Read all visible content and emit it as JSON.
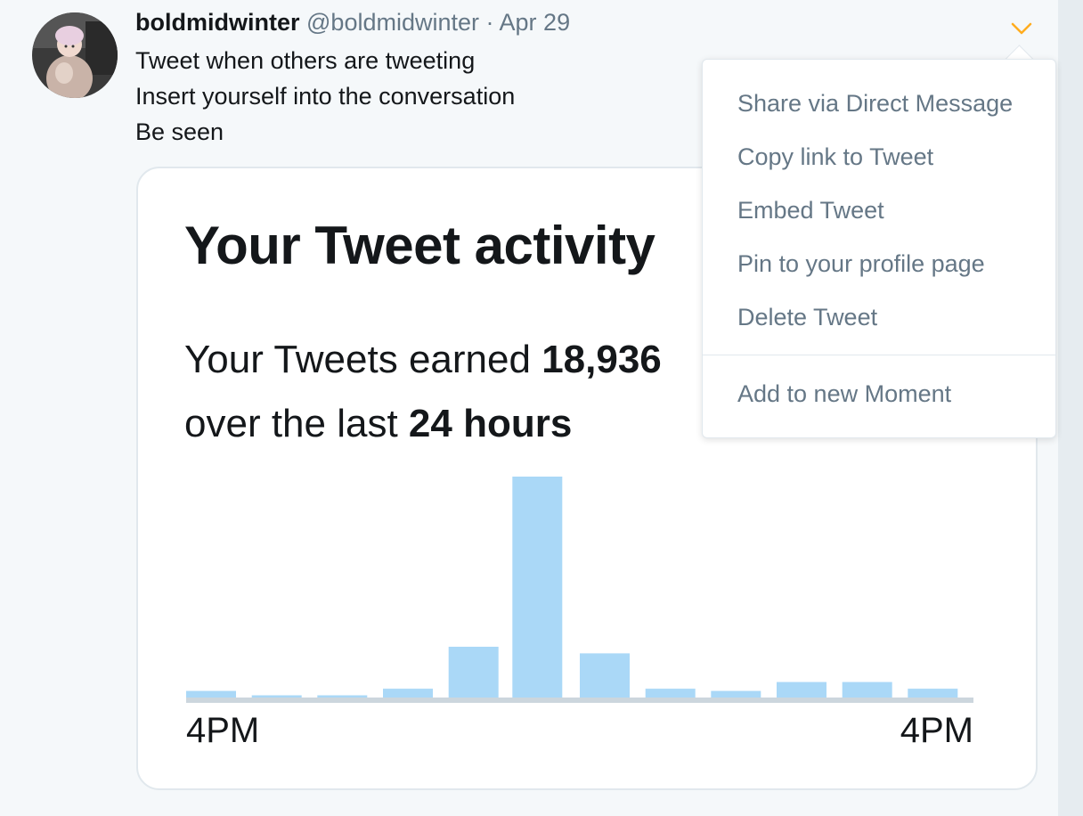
{
  "tweet": {
    "display_name": "boldmidwinter",
    "handle": "@boldmidwinter",
    "separator": "·",
    "date": "Apr 29",
    "lines": [
      "Tweet when others are tweeting",
      "Insert yourself into the conversation",
      "Be seen"
    ]
  },
  "card": {
    "title": "Your Tweet activity",
    "earned_prefix": "Your Tweets earned ",
    "earned_value": "18,936",
    "over_prefix": "over the last ",
    "over_value": "24 hours"
  },
  "chart_data": {
    "type": "bar",
    "categories": [
      "4PM",
      "",
      "",
      "",
      "",
      "",
      "",
      "",
      "",
      "",
      "",
      "4PM"
    ],
    "values": [
      3,
      1,
      1,
      4,
      23,
      100,
      20,
      4,
      3,
      7,
      7,
      4
    ],
    "x_tick_labels": [
      "4PM",
      "4PM"
    ],
    "title": "",
    "xlabel": "",
    "ylabel": "",
    "ylim": [
      0,
      100
    ],
    "grid": false,
    "colors": {
      "bar": "#aad8f7",
      "baseline": "#ccd6dd"
    }
  },
  "menu": {
    "items": [
      "Share via Direct Message",
      "Copy link to Tweet",
      "Embed Tweet",
      "Pin to your profile page",
      "Delete Tweet"
    ],
    "moment_item": "Add to new Moment"
  },
  "icons": {
    "caret": "chevron-down-icon",
    "avatar": "avatar"
  },
  "colors": {
    "caret": "#ffad1f",
    "secondary_text": "#657786",
    "primary_text": "#14171a"
  }
}
